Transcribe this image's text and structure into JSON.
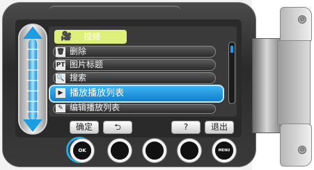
{
  "category": {
    "icon": "video-camera-icon",
    "label": "视频"
  },
  "menu_items": [
    {
      "icon": "trash-icon",
      "icon_glyph": "🗑",
      "label": "删除"
    },
    {
      "icon": "title-pt-icon",
      "icon_glyph": "PT",
      "label": "图片标题"
    },
    {
      "icon": "search-icon",
      "icon_glyph": "🔍",
      "label": "搜索"
    },
    {
      "icon": "play-playlist-icon",
      "icon_glyph": "▶",
      "label": "播放播放列表",
      "selected": true
    },
    {
      "icon": "edit-playlist-icon",
      "icon_glyph": "✎",
      "label": "编辑播放列表"
    }
  ],
  "soft_keys": {
    "confirm": "确定",
    "back": "⮌",
    "help": "?",
    "exit": "退出"
  },
  "physical_buttons": {
    "ok": "OK",
    "menu": "MENU"
  },
  "colors": {
    "accent": "#1e9ce0",
    "category_tab": "#dff07a",
    "selection": "#1f9be6"
  }
}
